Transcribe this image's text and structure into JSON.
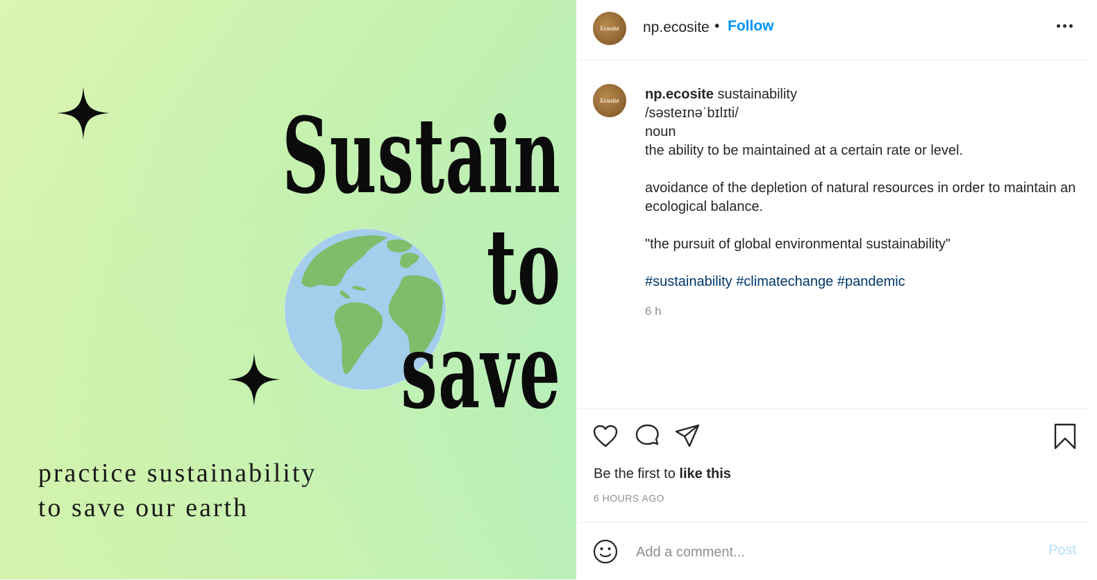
{
  "image": {
    "headline_words": [
      "Sustain",
      "to",
      "save"
    ],
    "tagline": [
      "practice sustainability",
      "to save our earth"
    ]
  },
  "header": {
    "avatar_text": "Ecosite",
    "username": "np.ecosite",
    "separator": "•",
    "follow_label": "Follow"
  },
  "caption": {
    "username": "np.ecosite",
    "lines": [
      "sustainability",
      "/səsteɪnəˈbɪlɪti/",
      "noun",
      "the ability to be maintained at a certain rate or level.",
      "",
      "avoidance of the depletion of natural resources in order to maintain an ecological balance.",
      "",
      "\"the pursuit of global environmental sustainability\"",
      ""
    ],
    "hashtags": [
      "#sustainability",
      "#climatechange",
      "#pandemic"
    ],
    "time": "6 h"
  },
  "actions": {
    "like_prefix": "Be the first to",
    "like_bold": "like this",
    "posted_ago": "6 HOURS AGO"
  },
  "comment": {
    "placeholder": "Add a comment...",
    "post_label": "Post"
  },
  "colors": {
    "follow": "#0095f6",
    "hashtag": "#00376b",
    "post_disabled": "#b2dffc"
  }
}
